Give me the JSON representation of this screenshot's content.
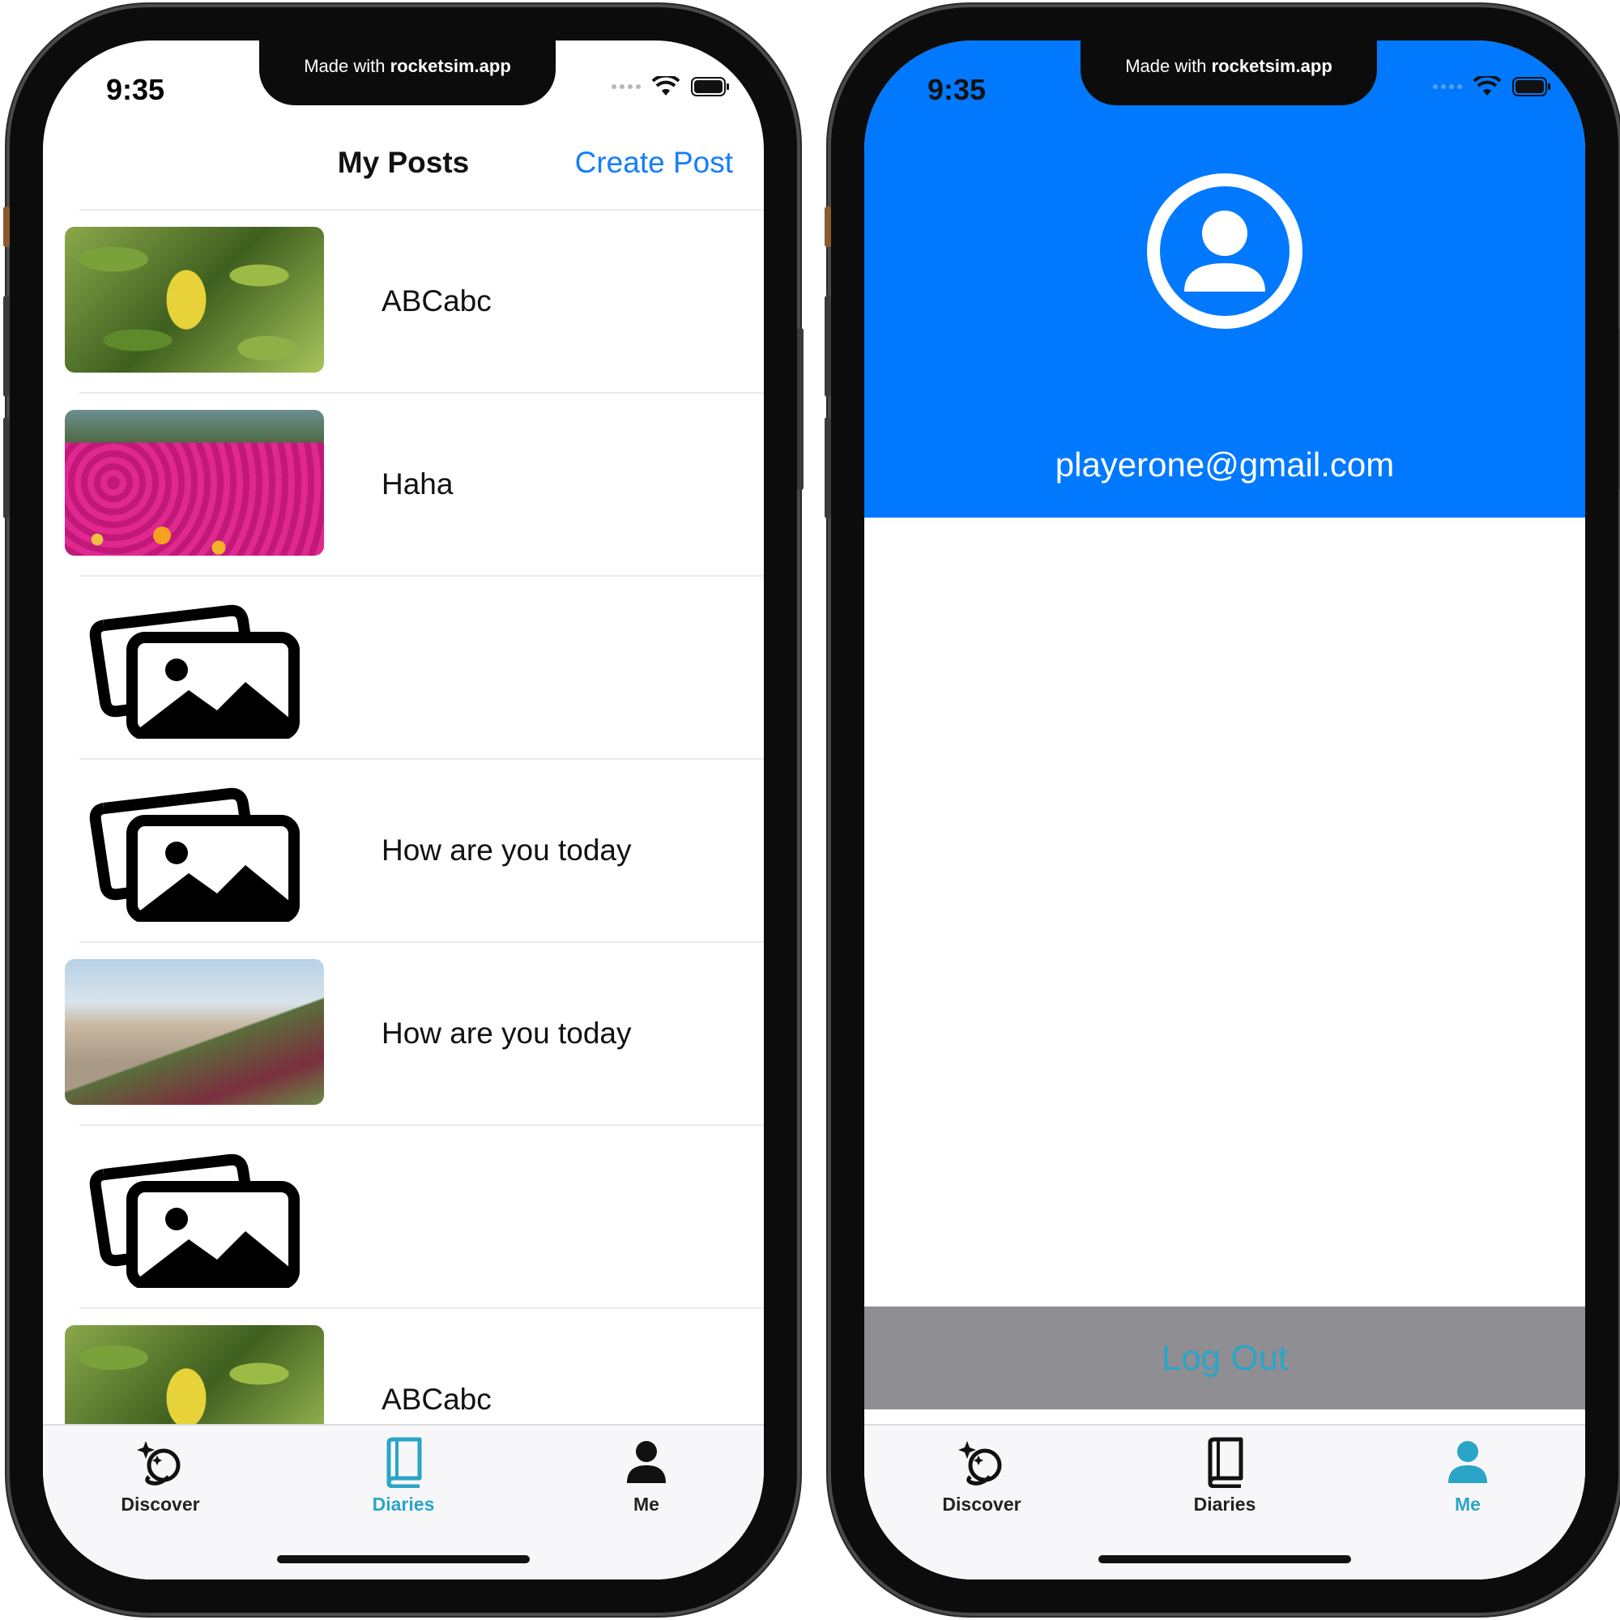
{
  "status_bar": {
    "time": "9:35"
  },
  "notch": {
    "text_prefix": "Made with",
    "text_brand": "rocketsim.app"
  },
  "left_screen": {
    "nav_title": "My Posts",
    "nav_action": "Create Post",
    "posts": [
      {
        "title": "ABCabc",
        "thumbnail": "photo-leaves"
      },
      {
        "title": "Haha",
        "thumbnail": "photo-flowers"
      },
      {
        "title": "",
        "thumbnail": "photo-placeholder-icon"
      },
      {
        "title": "How are you today",
        "thumbnail": "photo-placeholder-icon"
      },
      {
        "title": "How are you today",
        "thumbnail": "photo-dunes"
      },
      {
        "title": "",
        "thumbnail": "photo-placeholder-icon"
      },
      {
        "title": "ABCabc",
        "thumbnail": "photo-leaves"
      }
    ]
  },
  "right_screen": {
    "email": "playerone@gmail.com",
    "logout_label": "Log Out",
    "header_color": "#0079ff"
  },
  "tabs": [
    {
      "label": "Discover",
      "icon": "discover-sparkle-icon"
    },
    {
      "label": "Diaries",
      "icon": "book-icon"
    },
    {
      "label": "Me",
      "icon": "person-icon"
    }
  ],
  "colors": {
    "accent": "#147efb",
    "tab_active": "#2aa5c8",
    "logout_bg": "#8e8e93"
  }
}
